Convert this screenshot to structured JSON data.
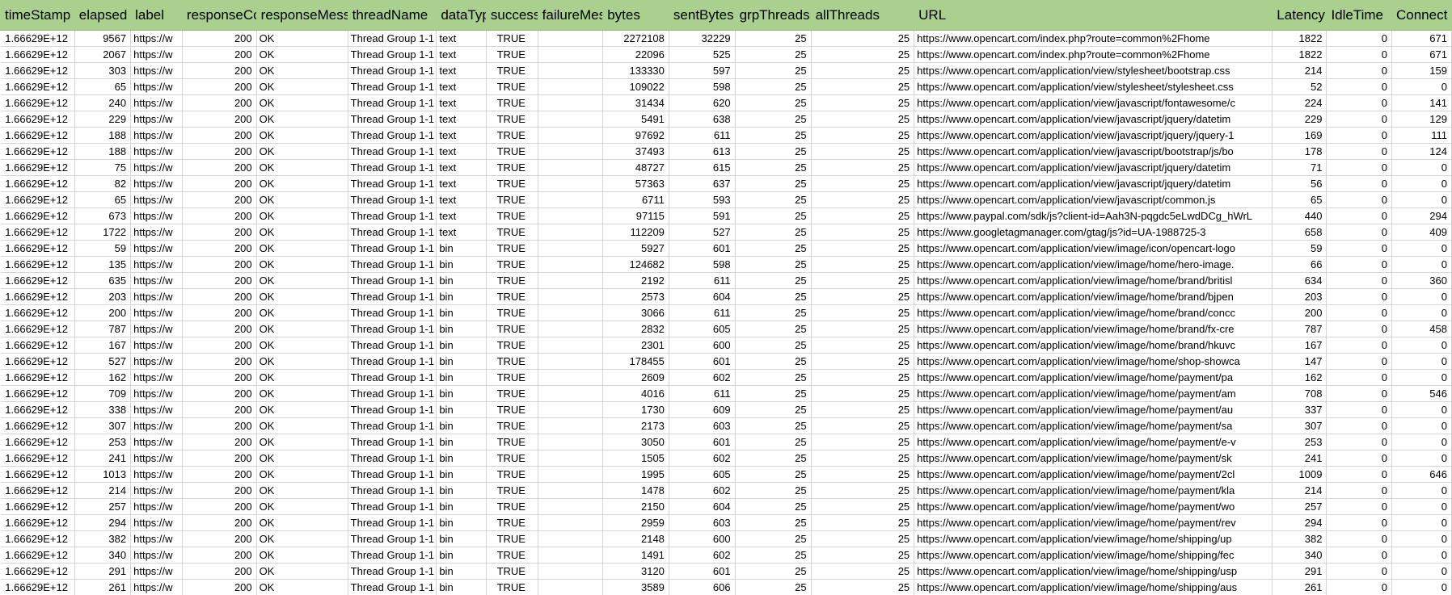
{
  "columns": [
    {
      "key": "timeStamp",
      "label": "timeStamp",
      "align": "c"
    },
    {
      "key": "elapsed",
      "label": "elapsed",
      "align": "r"
    },
    {
      "key": "label",
      "label": "label",
      "align": "l"
    },
    {
      "key": "responseCode",
      "label": "responseCo",
      "align": "r"
    },
    {
      "key": "responseMessage",
      "label": "responseMess",
      "align": "l"
    },
    {
      "key": "threadName",
      "label": "threadName",
      "align": "l"
    },
    {
      "key": "dataType",
      "label": "dataTyp",
      "align": "l"
    },
    {
      "key": "success",
      "label": "success",
      "align": "c"
    },
    {
      "key": "failureMessage",
      "label": "failureMes",
      "align": "l"
    },
    {
      "key": "bytes",
      "label": "bytes",
      "align": "r"
    },
    {
      "key": "sentBytes",
      "label": "sentBytes",
      "align": "r"
    },
    {
      "key": "grpThreads",
      "label": "grpThreads",
      "align": "r"
    },
    {
      "key": "allThreads",
      "label": "allThreads",
      "align": "r"
    },
    {
      "key": "URL",
      "label": "URL",
      "align": "l"
    },
    {
      "key": "Latency",
      "label": "Latency",
      "align": "r"
    },
    {
      "key": "IdleTime",
      "label": "IdleTime",
      "align": "r"
    },
    {
      "key": "Connect",
      "label": "Connect",
      "align": "r"
    }
  ],
  "rows": [
    [
      "1.66629E+12",
      "9567",
      "https://w",
      "200",
      "OK",
      "Thread Group 1-1",
      "text",
      "TRUE",
      "",
      "2272108",
      "32229",
      "25",
      "25",
      "https://www.opencart.com/index.php?route=common%2Fhome",
      "1822",
      "0",
      "671"
    ],
    [
      "1.66629E+12",
      "2067",
      "https://w",
      "200",
      "OK",
      "Thread Group 1-1",
      "text",
      "TRUE",
      "",
      "22096",
      "525",
      "25",
      "25",
      "https://www.opencart.com/index.php?route=common%2Fhome",
      "1822",
      "0",
      "671"
    ],
    [
      "1.66629E+12",
      "303",
      "https://w",
      "200",
      "OK",
      "Thread Group 1-1",
      "text",
      "TRUE",
      "",
      "133330",
      "597",
      "25",
      "25",
      "https://www.opencart.com/application/view/stylesheet/bootstrap.css",
      "214",
      "0",
      "159"
    ],
    [
      "1.66629E+12",
      "65",
      "https://w",
      "200",
      "OK",
      "Thread Group 1-1",
      "text",
      "TRUE",
      "",
      "109022",
      "598",
      "25",
      "25",
      "https://www.opencart.com/application/view/stylesheet/stylesheet.css",
      "52",
      "0",
      "0"
    ],
    [
      "1.66629E+12",
      "240",
      "https://w",
      "200",
      "OK",
      "Thread Group 1-1",
      "text",
      "TRUE",
      "",
      "31434",
      "620",
      "25",
      "25",
      "https://www.opencart.com/application/view/javascript/fontawesome/c",
      "224",
      "0",
      "141"
    ],
    [
      "1.66629E+12",
      "229",
      "https://w",
      "200",
      "OK",
      "Thread Group 1-1",
      "text",
      "TRUE",
      "",
      "5491",
      "638",
      "25",
      "25",
      "https://www.opencart.com/application/view/javascript/jquery/datetim",
      "229",
      "0",
      "129"
    ],
    [
      "1.66629E+12",
      "188",
      "https://w",
      "200",
      "OK",
      "Thread Group 1-1",
      "text",
      "TRUE",
      "",
      "97692",
      "611",
      "25",
      "25",
      "https://www.opencart.com/application/view/javascript/jquery/jquery-1",
      "169",
      "0",
      "111"
    ],
    [
      "1.66629E+12",
      "188",
      "https://w",
      "200",
      "OK",
      "Thread Group 1-1",
      "text",
      "TRUE",
      "",
      "37493",
      "613",
      "25",
      "25",
      "https://www.opencart.com/application/view/javascript/bootstrap/js/bo",
      "178",
      "0",
      "124"
    ],
    [
      "1.66629E+12",
      "75",
      "https://w",
      "200",
      "OK",
      "Thread Group 1-1",
      "text",
      "TRUE",
      "",
      "48727",
      "615",
      "25",
      "25",
      "https://www.opencart.com/application/view/javascript/jquery/datetim",
      "71",
      "0",
      "0"
    ],
    [
      "1.66629E+12",
      "82",
      "https://w",
      "200",
      "OK",
      "Thread Group 1-1",
      "text",
      "TRUE",
      "",
      "57363",
      "637",
      "25",
      "25",
      "https://www.opencart.com/application/view/javascript/jquery/datetim",
      "56",
      "0",
      "0"
    ],
    [
      "1.66629E+12",
      "65",
      "https://w",
      "200",
      "OK",
      "Thread Group 1-1",
      "text",
      "TRUE",
      "",
      "6711",
      "593",
      "25",
      "25",
      "https://www.opencart.com/application/view/javascript/common.js",
      "65",
      "0",
      "0"
    ],
    [
      "1.66629E+12",
      "673",
      "https://w",
      "200",
      "OK",
      "Thread Group 1-1",
      "text",
      "TRUE",
      "",
      "97115",
      "591",
      "25",
      "25",
      "https://www.paypal.com/sdk/js?client-id=Aah3N-pqgdc5eLwdDCg_hWrL",
      "440",
      "0",
      "294"
    ],
    [
      "1.66629E+12",
      "1722",
      "https://w",
      "200",
      "OK",
      "Thread Group 1-1",
      "text",
      "TRUE",
      "",
      "112209",
      "527",
      "25",
      "25",
      "https://www.googletagmanager.com/gtag/js?id=UA-1988725-3",
      "658",
      "0",
      "409"
    ],
    [
      "1.66629E+12",
      "59",
      "https://w",
      "200",
      "OK",
      "Thread Group 1-1",
      "bin",
      "TRUE",
      "",
      "5927",
      "601",
      "25",
      "25",
      "https://www.opencart.com/application/view/image/icon/opencart-logo",
      "59",
      "0",
      "0"
    ],
    [
      "1.66629E+12",
      "135",
      "https://w",
      "200",
      "OK",
      "Thread Group 1-1",
      "bin",
      "TRUE",
      "",
      "124682",
      "598",
      "25",
      "25",
      "https://www.opencart.com/application/view/image/home/hero-image.",
      "66",
      "0",
      "0"
    ],
    [
      "1.66629E+12",
      "635",
      "https://w",
      "200",
      "OK",
      "Thread Group 1-1",
      "bin",
      "TRUE",
      "",
      "2192",
      "611",
      "25",
      "25",
      "https://www.opencart.com/application/view/image/home/brand/britisl",
      "634",
      "0",
      "360"
    ],
    [
      "1.66629E+12",
      "203",
      "https://w",
      "200",
      "OK",
      "Thread Group 1-1",
      "bin",
      "TRUE",
      "",
      "2573",
      "604",
      "25",
      "25",
      "https://www.opencart.com/application/view/image/home/brand/bjpen",
      "203",
      "0",
      "0"
    ],
    [
      "1.66629E+12",
      "200",
      "https://w",
      "200",
      "OK",
      "Thread Group 1-1",
      "bin",
      "TRUE",
      "",
      "3066",
      "611",
      "25",
      "25",
      "https://www.opencart.com/application/view/image/home/brand/concc",
      "200",
      "0",
      "0"
    ],
    [
      "1.66629E+12",
      "787",
      "https://w",
      "200",
      "OK",
      "Thread Group 1-1",
      "bin",
      "TRUE",
      "",
      "2832",
      "605",
      "25",
      "25",
      "https://www.opencart.com/application/view/image/home/brand/fx-cre",
      "787",
      "0",
      "458"
    ],
    [
      "1.66629E+12",
      "167",
      "https://w",
      "200",
      "OK",
      "Thread Group 1-1",
      "bin",
      "TRUE",
      "",
      "2301",
      "600",
      "25",
      "25",
      "https://www.opencart.com/application/view/image/home/brand/hkuvc",
      "167",
      "0",
      "0"
    ],
    [
      "1.66629E+12",
      "527",
      "https://w",
      "200",
      "OK",
      "Thread Group 1-1",
      "bin",
      "TRUE",
      "",
      "178455",
      "601",
      "25",
      "25",
      "https://www.opencart.com/application/view/image/home/shop-showca",
      "147",
      "0",
      "0"
    ],
    [
      "1.66629E+12",
      "162",
      "https://w",
      "200",
      "OK",
      "Thread Group 1-1",
      "bin",
      "TRUE",
      "",
      "2609",
      "602",
      "25",
      "25",
      "https://www.opencart.com/application/view/image/home/payment/pa",
      "162",
      "0",
      "0"
    ],
    [
      "1.66629E+12",
      "709",
      "https://w",
      "200",
      "OK",
      "Thread Group 1-1",
      "bin",
      "TRUE",
      "",
      "4016",
      "611",
      "25",
      "25",
      "https://www.opencart.com/application/view/image/home/payment/am",
      "708",
      "0",
      "546"
    ],
    [
      "1.66629E+12",
      "338",
      "https://w",
      "200",
      "OK",
      "Thread Group 1-1",
      "bin",
      "TRUE",
      "",
      "1730",
      "609",
      "25",
      "25",
      "https://www.opencart.com/application/view/image/home/payment/au",
      "337",
      "0",
      "0"
    ],
    [
      "1.66629E+12",
      "307",
      "https://w",
      "200",
      "OK",
      "Thread Group 1-1",
      "bin",
      "TRUE",
      "",
      "2173",
      "603",
      "25",
      "25",
      "https://www.opencart.com/application/view/image/home/payment/sa",
      "307",
      "0",
      "0"
    ],
    [
      "1.66629E+12",
      "253",
      "https://w",
      "200",
      "OK",
      "Thread Group 1-1",
      "bin",
      "TRUE",
      "",
      "3050",
      "601",
      "25",
      "25",
      "https://www.opencart.com/application/view/image/home/payment/e-v",
      "253",
      "0",
      "0"
    ],
    [
      "1.66629E+12",
      "241",
      "https://w",
      "200",
      "OK",
      "Thread Group 1-1",
      "bin",
      "TRUE",
      "",
      "1505",
      "602",
      "25",
      "25",
      "https://www.opencart.com/application/view/image/home/payment/sk",
      "241",
      "0",
      "0"
    ],
    [
      "1.66629E+12",
      "1013",
      "https://w",
      "200",
      "OK",
      "Thread Group 1-1",
      "bin",
      "TRUE",
      "",
      "1995",
      "605",
      "25",
      "25",
      "https://www.opencart.com/application/view/image/home/payment/2cl",
      "1009",
      "0",
      "646"
    ],
    [
      "1.66629E+12",
      "214",
      "https://w",
      "200",
      "OK",
      "Thread Group 1-1",
      "bin",
      "TRUE",
      "",
      "1478",
      "602",
      "25",
      "25",
      "https://www.opencart.com/application/view/image/home/payment/kla",
      "214",
      "0",
      "0"
    ],
    [
      "1.66629E+12",
      "257",
      "https://w",
      "200",
      "OK",
      "Thread Group 1-1",
      "bin",
      "TRUE",
      "",
      "2150",
      "604",
      "25",
      "25",
      "https://www.opencart.com/application/view/image/home/payment/wo",
      "257",
      "0",
      "0"
    ],
    [
      "1.66629E+12",
      "294",
      "https://w",
      "200",
      "OK",
      "Thread Group 1-1",
      "bin",
      "TRUE",
      "",
      "2959",
      "603",
      "25",
      "25",
      "https://www.opencart.com/application/view/image/home/payment/rev",
      "294",
      "0",
      "0"
    ],
    [
      "1.66629E+12",
      "382",
      "https://w",
      "200",
      "OK",
      "Thread Group 1-1",
      "bin",
      "TRUE",
      "",
      "2148",
      "600",
      "25",
      "25",
      "https://www.opencart.com/application/view/image/home/shipping/up",
      "382",
      "0",
      "0"
    ],
    [
      "1.66629E+12",
      "340",
      "https://w",
      "200",
      "OK",
      "Thread Group 1-1",
      "bin",
      "TRUE",
      "",
      "1491",
      "602",
      "25",
      "25",
      "https://www.opencart.com/application/view/image/home/shipping/fec",
      "340",
      "0",
      "0"
    ],
    [
      "1.66629E+12",
      "291",
      "https://w",
      "200",
      "OK",
      "Thread Group 1-1",
      "bin",
      "TRUE",
      "",
      "3120",
      "601",
      "25",
      "25",
      "https://www.opencart.com/application/view/image/home/shipping/usp",
      "291",
      "0",
      "0"
    ],
    [
      "1.66629E+12",
      "261",
      "https://w",
      "200",
      "OK",
      "Thread Group 1-1",
      "bin",
      "TRUE",
      "",
      "3589",
      "606",
      "25",
      "25",
      "https://www.opencart.com/application/view/image/home/shipping/aus",
      "261",
      "0",
      "0"
    ]
  ],
  "colors": {
    "header_bg": "#a9d08e",
    "grid_line": "#d4d4d4"
  }
}
